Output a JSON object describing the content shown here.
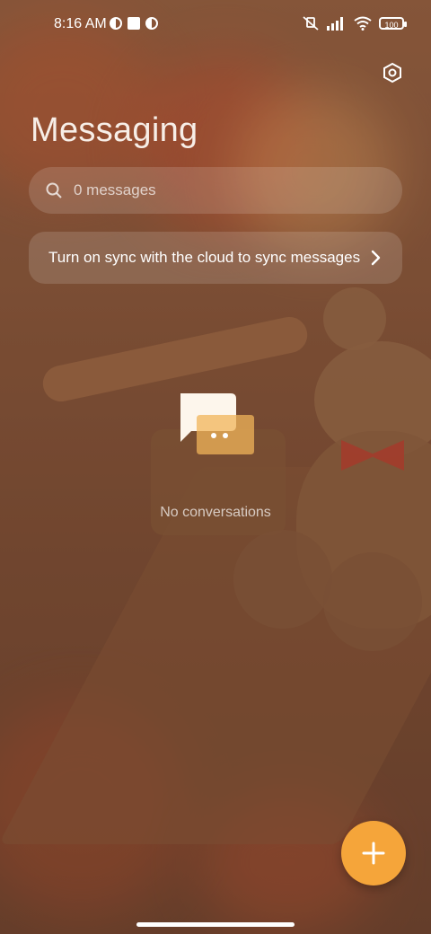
{
  "status_bar": {
    "time": "8:16 AM",
    "battery": "100",
    "icons": [
      "mute-icon",
      "signal-icon",
      "wifi-icon",
      "battery-icon"
    ]
  },
  "header": {
    "title": "Messaging",
    "settings_icon": "settings-icon"
  },
  "search": {
    "placeholder": "0 messages",
    "icon": "search-icon"
  },
  "sync_banner": {
    "text": "Turn on sync with the cloud to sync messages",
    "icon": "chevron-right-icon"
  },
  "empty_state": {
    "icon": "chat-bubbles-icon",
    "label": "No conversations"
  },
  "fab": {
    "icon": "plus-icon",
    "color": "#f5a53a"
  }
}
